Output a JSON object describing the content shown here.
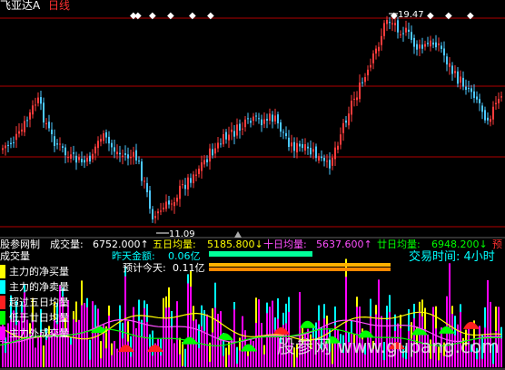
{
  "header": {
    "stock_name": "飞亚达A",
    "period": "日线"
  },
  "price_panel": {
    "high_label": "19.47",
    "low_label": "11.09"
  },
  "info_line": [
    {
      "label": "股参网制",
      "value": ""
    },
    {
      "label": "成交量:",
      "value": "6752.000↑"
    },
    {
      "label": "五日均量:",
      "value": "5185.800↓"
    },
    {
      "label": "十日均量:",
      "value": "5637.600↑"
    },
    {
      "label": "廿日均量:",
      "value": "6948.200↓"
    },
    {
      "label": "预",
      "value": ""
    }
  ],
  "volume_title": "成交量",
  "amounts": {
    "yesterday_label": "昨天金额:",
    "yesterday_value": "0.06亿",
    "today_label": "预计今天:",
    "today_value": "0.11亿"
  },
  "trade_time": "交易时间: 4小时",
  "legend": [
    {
      "label": "主力的净买量",
      "color": "#ffff00"
    },
    {
      "label": "主力的净卖量",
      "color": "#00ffff"
    },
    {
      "label": "超过五日均量",
      "color": "#ff2020"
    },
    {
      "label": "低于廿日均量",
      "color": "#00ff00"
    },
    {
      "label": "主力外成交量",
      "color": "#ff00ff"
    }
  ],
  "watermark": "股参网 www.gupang.com",
  "colors": {
    "up": "#ff3c3c",
    "down": "#4cc8ff",
    "ma_cyan": "#00ffff",
    "ma_pink": "#ff4fff",
    "ma_yellow": "#ffff00",
    "ma_green": "#00ff00",
    "grid": "#b00000"
  }
}
